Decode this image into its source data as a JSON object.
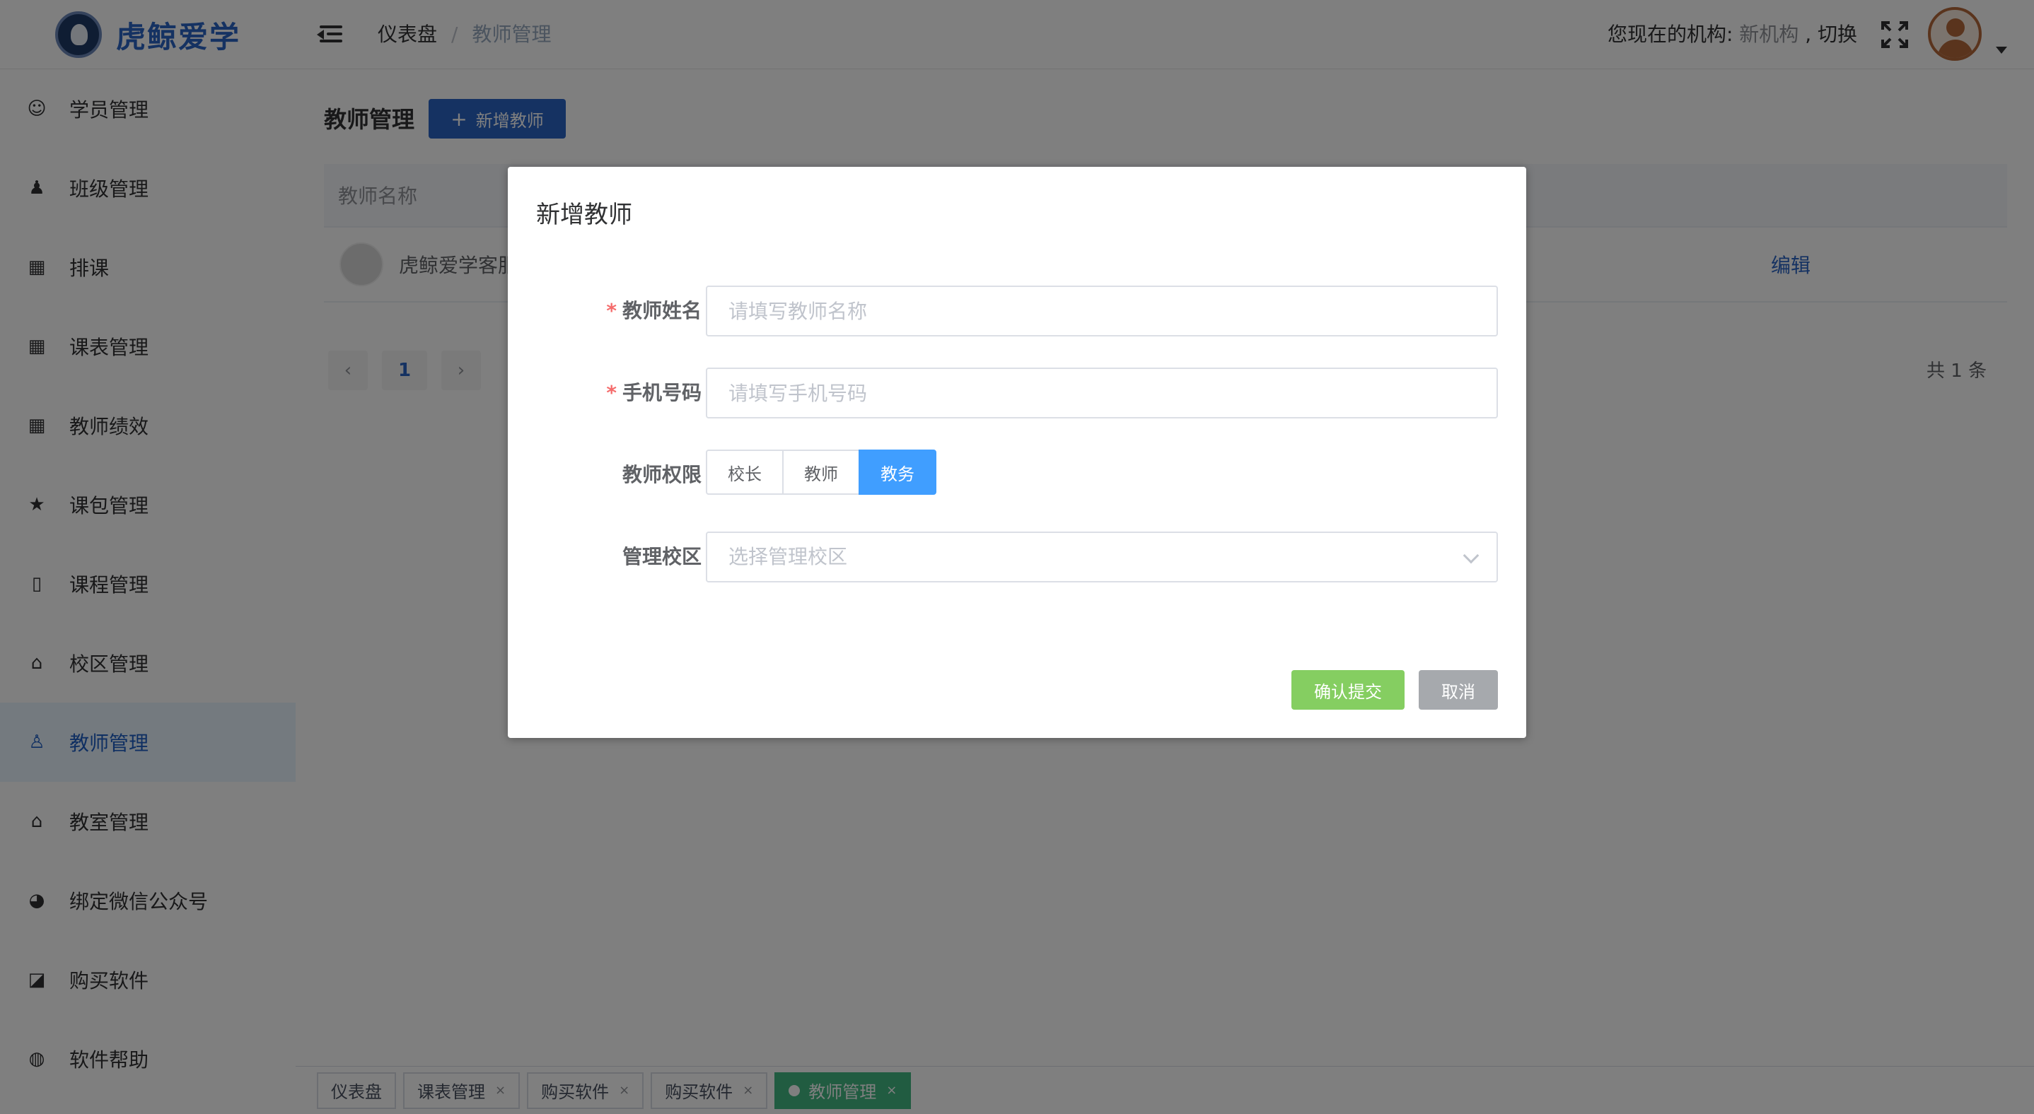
{
  "app": {
    "logo_text": "虎鲸爱学"
  },
  "header": {
    "breadcrumb": [
      "仪表盘",
      "教师管理"
    ],
    "breadcrumb_separator": "/",
    "org_prefix": "您现在的机构: ",
    "org_name": "新机构",
    "org_switch": " , 切换"
  },
  "sidebar": {
    "active": "教师管理",
    "items": [
      {
        "label": "学员管理",
        "icon": "student-icon"
      },
      {
        "label": "班级管理",
        "icon": "people-icon"
      },
      {
        "label": "排课",
        "icon": "calendar-icon"
      },
      {
        "label": "课表管理",
        "icon": "table-icon"
      },
      {
        "label": "教师绩效",
        "icon": "table-icon"
      },
      {
        "label": "课包管理",
        "icon": "star-icon"
      },
      {
        "label": "课程管理",
        "icon": "book-icon"
      },
      {
        "label": "校区管理",
        "icon": "school-icon"
      },
      {
        "label": "教师管理",
        "icon": "teacher-icon"
      },
      {
        "label": "教室管理",
        "icon": "school-icon"
      },
      {
        "label": "绑定微信公众号",
        "icon": "wechat-icon"
      },
      {
        "label": "购买软件",
        "icon": "vip-icon"
      },
      {
        "label": "软件帮助",
        "icon": "globe-icon"
      }
    ]
  },
  "main": {
    "title": "教师管理",
    "add_button": "新增教师",
    "table": {
      "columns": [
        "教师名称"
      ],
      "rows": [
        {
          "name": "虎鲸爱学客服",
          "action": "编辑"
        }
      ]
    },
    "pagination": {
      "current_page": "1",
      "total": "共 1 条"
    }
  },
  "tags": [
    {
      "label": "仪表盘",
      "closable": false,
      "active": false
    },
    {
      "label": "课表管理",
      "closable": true,
      "active": false
    },
    {
      "label": "购买软件",
      "closable": true,
      "active": false
    },
    {
      "label": "购买软件",
      "closable": true,
      "active": false
    },
    {
      "label": "教师管理",
      "closable": true,
      "active": true
    }
  ],
  "dialog": {
    "title": "新增教师",
    "fields": {
      "teacher_name": {
        "label": "教师姓名",
        "required": true,
        "placeholder": "请填写教师名称",
        "value": ""
      },
      "phone": {
        "label": "手机号码",
        "required": true,
        "placeholder": "请填写手机号码",
        "value": ""
      },
      "permission": {
        "label": "教师权限",
        "options": [
          "校长",
          "教师",
          "教务"
        ],
        "selected": "教务"
      },
      "campus": {
        "label": "管理校区",
        "placeholder": "选择管理校区"
      }
    },
    "confirm_label": "确认提交",
    "cancel_label": "取消"
  },
  "colors": {
    "primary": "#2b64c5",
    "selected_radio": "#409eff",
    "confirm": "#85ce61",
    "cancel": "#a6a9ad",
    "active_tag": "#42b983",
    "required": "#f56c6c"
  }
}
